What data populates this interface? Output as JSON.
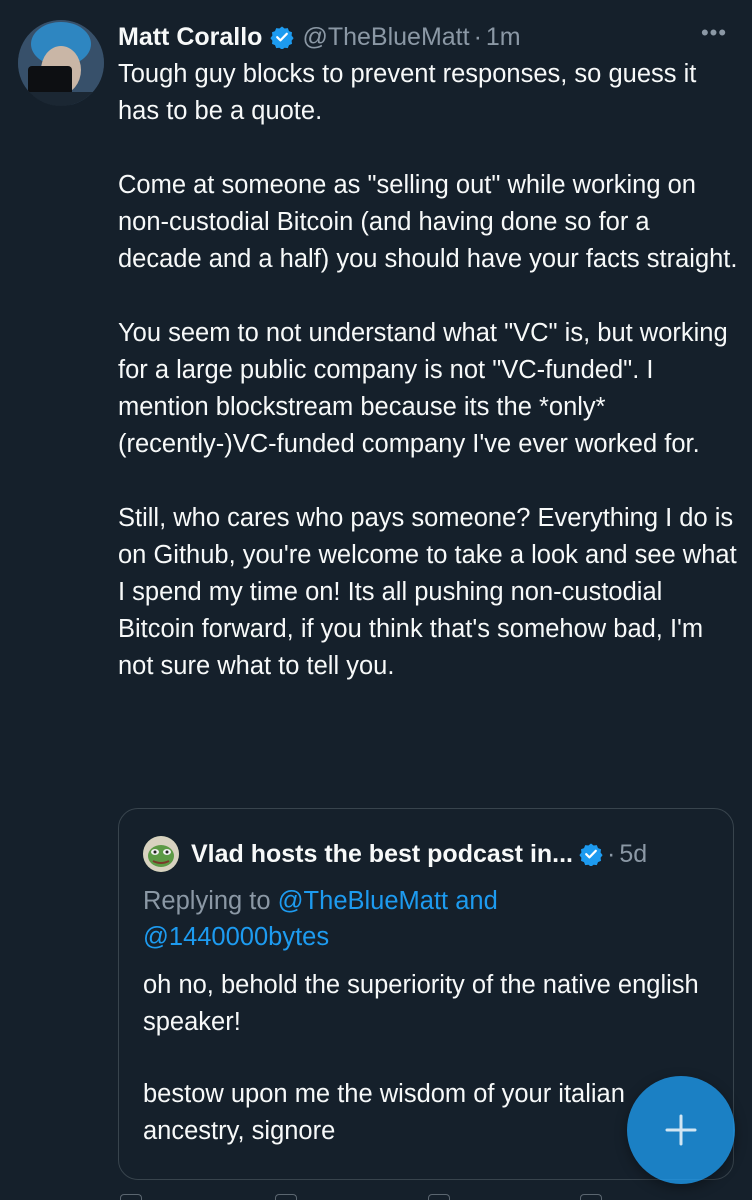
{
  "tweet": {
    "author_name": "Matt Corallo",
    "handle": "@TheBlueMatt",
    "separator": "·",
    "time": "1m",
    "more_label": "•••",
    "paragraphs": [
      "Tough guy blocks to prevent responses, so guess it has to be a quote.",
      "Come at someone as \"selling out\" while working on non-custodial Bitcoin (and having done so for a decade and a half) you should have your facts straight.",
      "You seem to not understand what \"VC\" is, but working for a large public company is not \"VC-funded\".  I mention blockstream because its the *only* (recently-)VC-funded company I've ever worked for.",
      "Still, who cares who pays someone? Everything I do is on Github, you're welcome to take a look and see what I spend my time on! Its all pushing non-custodial Bitcoin forward, if you think that's somehow bad, I'm not sure what to tell you."
    ]
  },
  "quote": {
    "author_name": "Vlad hosts the best podcast in...",
    "separator": "·",
    "time": "5d",
    "replying_prefix": "Replying to ",
    "mention_1": "@TheBlueMatt",
    "and_word": " and",
    "mention_2": "@1440000bytes",
    "paragraphs": [
      "oh no, behold the superiority of the native english speaker!",
      "bestow upon me the wisdom of your italian ancestry, signore"
    ]
  },
  "compose_button": {
    "icon": "plus-icon"
  },
  "colors": {
    "background": "#15202b",
    "text": "#f7f9f9",
    "muted": "#8b98a5",
    "accent": "#1d9bf0",
    "border": "#38444d"
  }
}
